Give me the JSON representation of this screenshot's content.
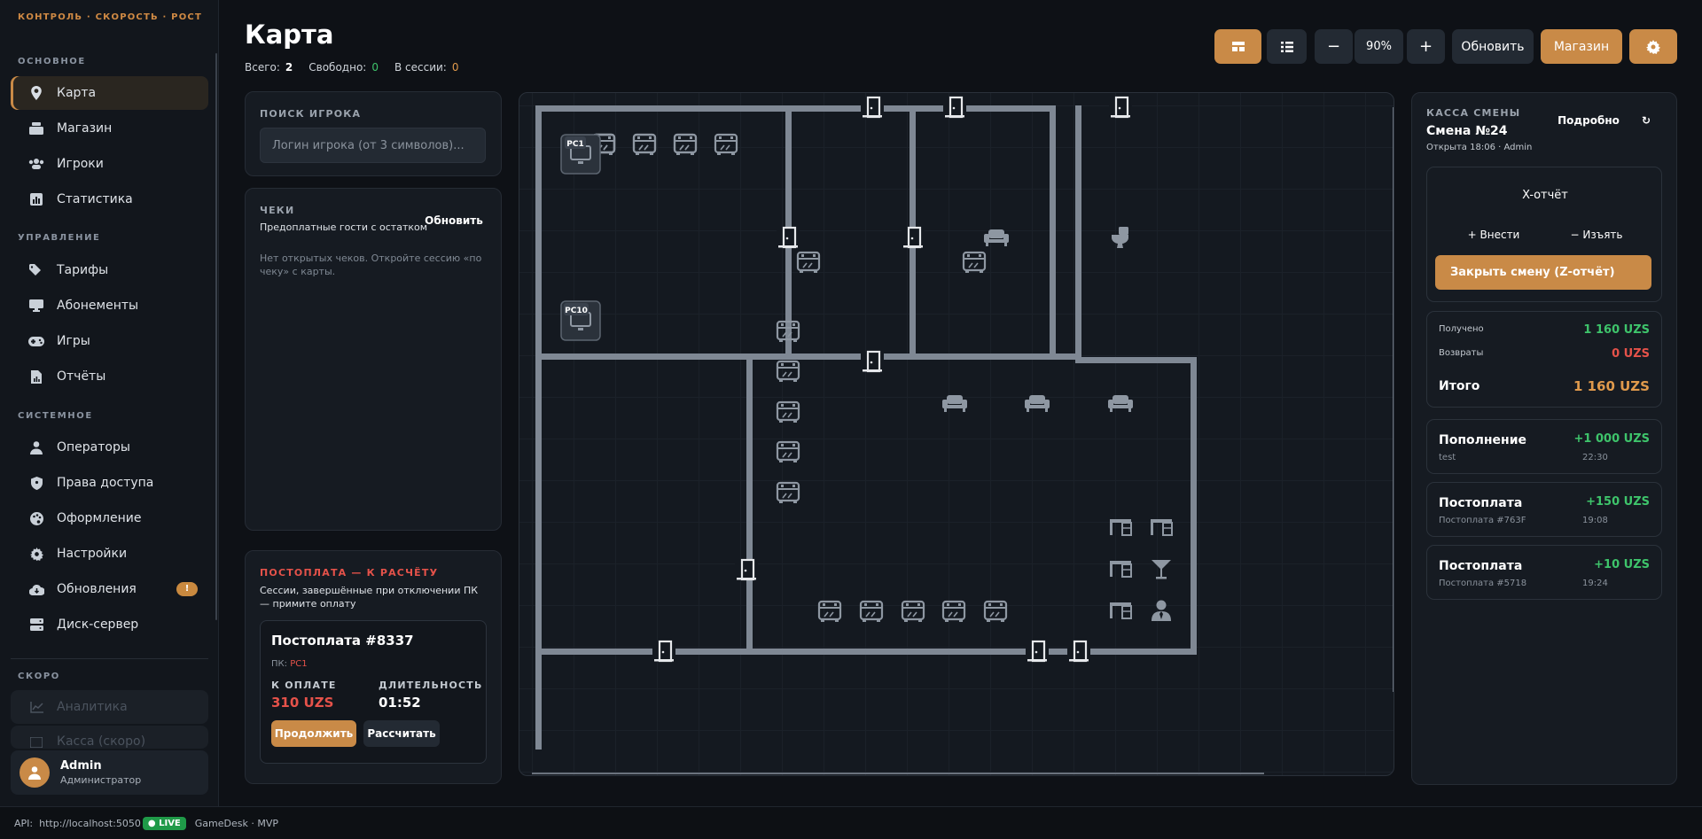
{
  "sidebar": {
    "brand": "КОНТРОЛЬ · СКОРОСТЬ · РОСТ",
    "sections": {
      "main": "ОСНОВНОЕ",
      "manage": "УПРАВЛЕНИЕ",
      "system": "СИСТЕМНОЕ",
      "soon": "СКОРО"
    },
    "items": {
      "map": "Карта",
      "shop": "Магазин",
      "players": "Игроки",
      "stats": "Статистика",
      "tariffs": "Тарифы",
      "subs": "Абонементы",
      "games": "Игры",
      "reports": "Отчёты",
      "operators": "Операторы",
      "access": "Права доступа",
      "design": "Оформление",
      "settings": "Настройки",
      "updates": "Обновления",
      "updates_badge": "!",
      "disk": "Диск-сервер",
      "analytics": "Аналитика",
      "kassa_soon": "Касса (скоро)"
    },
    "user": {
      "name": "Admin",
      "role": "Администратор"
    }
  },
  "header": {
    "title": "Карта",
    "total_label": "Всего:",
    "total": "2",
    "free_label": "Свободно:",
    "free": "0",
    "session_label": "В сессии:",
    "session": "0"
  },
  "toolbar": {
    "zoom": "90%",
    "minus": "−",
    "plus": "+",
    "refresh": "Обновить",
    "shop": "Магазин"
  },
  "search": {
    "label": "ПОИСК ИГРОКА",
    "placeholder": "Логин игрока (от 3 символов)..."
  },
  "checks": {
    "label": "ЧЕКИ",
    "subtitle": "Предоплатные гости с остатком",
    "refresh": "Обновить",
    "empty": "Нет открытых чеков. Откройте сессию «по чеку» с карты."
  },
  "postpay": {
    "label": "ПОСТОПЛАТА — К РАСЧЁТУ",
    "desc": "Сессии, завершённые при отключении ПК — примите оплату",
    "card_title": "Постоплата #8337",
    "pc_label": "ПК:",
    "pc": "PC1",
    "due_label": "К ОПЛАТЕ",
    "due": "310 UZS",
    "dur_label": "ДЛИТЕЛЬНОСТЬ",
    "dur": "01:52",
    "continue": "Продолжить",
    "settle": "Рассчитать"
  },
  "map": {
    "pc1": "PC1",
    "pc10": "PC10"
  },
  "shift": {
    "label": "КАССА СМЕНЫ",
    "title": "Смена №24",
    "opened": "Открыта 18:06 · Admin",
    "details": "Подробно",
    "refresh_icon": "↻",
    "x_report": "X-отчёт",
    "deposit": "+ Внести",
    "withdraw": "− Изъять",
    "close": "Закрыть смену (Z-отчёт)",
    "received_label": "Получено",
    "received": "1 160 UZS",
    "refunds_label": "Возвраты",
    "refunds": "0 UZS",
    "total_label": "Итого",
    "total": "1 160 UZS",
    "tx": [
      {
        "title": "Пополнение",
        "sub": "test",
        "amount": "+1 000 UZS",
        "time": "22:30"
      },
      {
        "title": "Постоплата",
        "sub": "Постоплата #763F",
        "amount": "+150 UZS",
        "time": "19:08"
      },
      {
        "title": "Постоплата",
        "sub": "Постоплата #5718",
        "amount": "+10 UZS",
        "time": "19:24"
      }
    ]
  },
  "footer": {
    "api_label": "API:",
    "api": "http://localhost:5050",
    "live": "● LIVE",
    "app": "GameDesk · MVP"
  }
}
